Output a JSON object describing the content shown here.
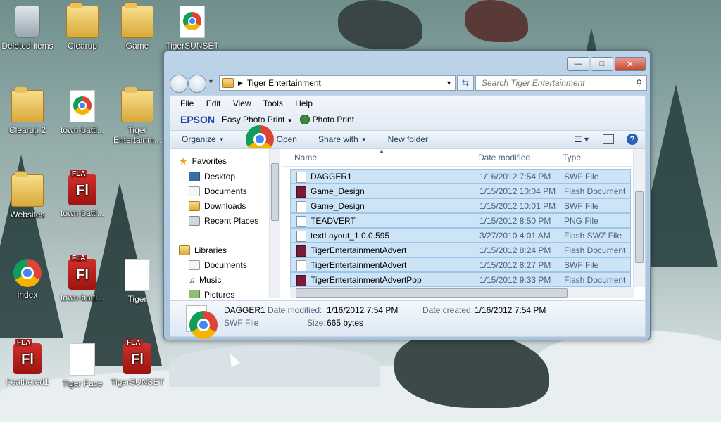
{
  "desktop": {
    "icons": [
      {
        "label": "Deleted items",
        "type": "bin"
      },
      {
        "label": "Clearup",
        "type": "folder"
      },
      {
        "label": "Game",
        "type": "folder"
      },
      {
        "label": "TigerSUNSET",
        "type": "chromedoc"
      },
      {
        "label": "Clearup 2",
        "type": "folder"
      },
      {
        "label": "town-battl...",
        "type": "chromedoc"
      },
      {
        "label": "Tiger Entertainm...",
        "type": "folder"
      },
      {
        "label": "Websites",
        "type": "folder"
      },
      {
        "label": "town-battl...",
        "type": "fla"
      },
      {
        "label": "index",
        "type": "chrome"
      },
      {
        "label": "town-battl...",
        "type": "fla"
      },
      {
        "label": "Tiger",
        "type": "doc"
      },
      {
        "label": "Feathered1",
        "type": "fla"
      },
      {
        "label": "Tiger Face",
        "type": "doc"
      },
      {
        "label": "TigerSUNSET",
        "type": "fla"
      }
    ],
    "fla_tag": "FLA",
    "fla_glyph": "Fl"
  },
  "window": {
    "address": "Tiger Entertainment",
    "search_placeholder": "Search Tiger Entertainment",
    "menu": [
      "File",
      "Edit",
      "View",
      "Tools",
      "Help"
    ],
    "epson": {
      "brand": "EPSON",
      "easy_photo_print": "Easy Photo Print",
      "photo_print": "Photo Print"
    },
    "commands": {
      "organize": "Organize",
      "open": "Open",
      "share_with": "Share with",
      "new_folder": "New folder"
    },
    "nav": {
      "favorites": "Favorites",
      "favorites_items": [
        "Desktop",
        "Documents",
        "Downloads",
        "Recent Places"
      ],
      "libraries": "Libraries",
      "libraries_items": [
        "Documents",
        "Music",
        "Pictures"
      ]
    },
    "columns": {
      "name": "Name",
      "date": "Date modified",
      "type": "Type"
    },
    "files": [
      {
        "name": "DAGGER1",
        "date": "1/16/2012 7:54 PM",
        "type": "SWF File",
        "icon": "swf"
      },
      {
        "name": "Game_Design",
        "date": "1/15/2012 10:04 PM",
        "type": "Flash Document",
        "icon": "flash"
      },
      {
        "name": "Game_Design",
        "date": "1/15/2012 10:01 PM",
        "type": "SWF File",
        "icon": "swf"
      },
      {
        "name": "TEADVERT",
        "date": "1/15/2012 8:50 PM",
        "type": "PNG File",
        "icon": "png"
      },
      {
        "name": "textLayout_1.0.0.595",
        "date": "3/27/2010 4:01 AM",
        "type": "Flash SWZ File",
        "icon": "swz"
      },
      {
        "name": "TigerEntertainmentAdvert",
        "date": "1/15/2012 8:24 PM",
        "type": "Flash Document",
        "icon": "flash"
      },
      {
        "name": "TigerEntertainmentAdvert",
        "date": "1/15/2012 8:27 PM",
        "type": "SWF File",
        "icon": "swf"
      },
      {
        "name": "TigerEntertainmentAdvertPop",
        "date": "1/15/2012 9:33 PM",
        "type": "Flash Document",
        "icon": "flash"
      }
    ],
    "details": {
      "name": "DAGGER1",
      "type": "SWF File",
      "date_modified_label": "Date modified:",
      "date_modified": "1/16/2012 7:54 PM",
      "date_created_label": "Date created:",
      "date_created": "1/16/2012 7:54 PM",
      "size_label": "Size:",
      "size": "665 bytes"
    }
  }
}
